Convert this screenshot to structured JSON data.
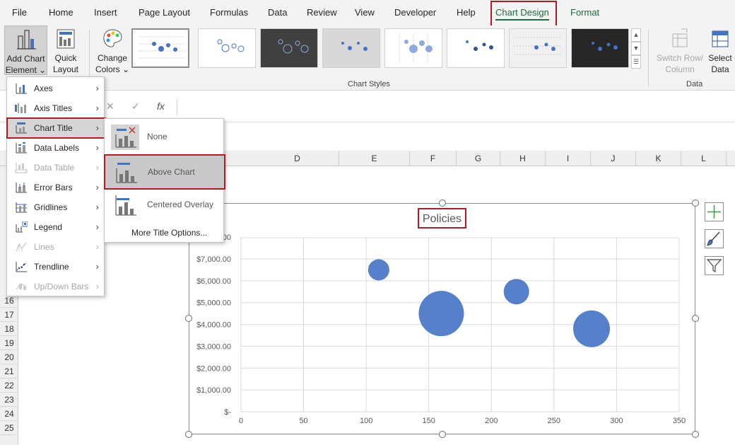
{
  "ribbon": {
    "tabs": [
      {
        "label": "File"
      },
      {
        "label": "Home"
      },
      {
        "label": "Insert"
      },
      {
        "label": "Page Layout"
      },
      {
        "label": "Formulas"
      },
      {
        "label": "Data"
      },
      {
        "label": "Review"
      },
      {
        "label": "View"
      },
      {
        "label": "Developer"
      },
      {
        "label": "Help"
      },
      {
        "label": "Chart Design"
      },
      {
        "label": "Format"
      }
    ],
    "buttons": {
      "add_chart_element_1": "Add Chart",
      "add_chart_element_2": "Element ⌄",
      "quick_layout_1": "Quick",
      "quick_layout_2": "Layout ⌄",
      "change_colors_1": "Change",
      "change_colors_2": "Colors ⌄",
      "switch_row_1": "Switch Row/",
      "switch_row_2": "Column",
      "select_data_1": "Select",
      "select_data_2": "Data"
    },
    "groups": {
      "chart_styles": "Chart Styles",
      "data": "Data"
    }
  },
  "formula_bar": {
    "cancel": "✕",
    "enter": "✓",
    "fx": "fx"
  },
  "columns": [
    "D",
    "E",
    "F",
    "G",
    "H",
    "I",
    "J",
    "K",
    "L"
  ],
  "rows": [
    "16",
    "17",
    "18",
    "19",
    "20",
    "21",
    "22",
    "23",
    "24",
    "25"
  ],
  "menu": {
    "items": [
      {
        "label": "Axes",
        "icon": "axes-icon"
      },
      {
        "label": "Axis Titles",
        "icon": "axis-titles-icon"
      },
      {
        "label": "Chart Title",
        "icon": "chart-title-icon"
      },
      {
        "label": "Data Labels",
        "icon": "data-labels-icon"
      },
      {
        "label": "Data Table",
        "icon": "data-table-icon"
      },
      {
        "label": "Error Bars",
        "icon": "error-bars-icon"
      },
      {
        "label": "Gridlines",
        "icon": "gridlines-icon"
      },
      {
        "label": "Legend",
        "icon": "legend-icon"
      },
      {
        "label": "Lines",
        "icon": "lines-icon"
      },
      {
        "label": "Trendline",
        "icon": "trendline-icon"
      },
      {
        "label": "Up/Down Bars",
        "icon": "up-down-bars-icon"
      }
    ],
    "submenu": {
      "items": [
        {
          "label": "None"
        },
        {
          "label": "Above Chart"
        },
        {
          "label": "Centered Overlay"
        }
      ],
      "more": "More Title Options..."
    }
  },
  "chart_data": {
    "type": "scatter",
    "title": "Policies",
    "xlim": [
      0,
      350
    ],
    "ylim": [
      0,
      7000
    ],
    "x_ticks": [
      "0",
      "50",
      "100",
      "150",
      "200",
      "250",
      "300",
      "350"
    ],
    "y_ticks": [
      "$-",
      "$1,000.00",
      "$2,000.00",
      "$3,000.00",
      "$4,000.00",
      "$5,000.00",
      "$6,000.00",
      "$7,000.00"
    ],
    "y_top_partial": "00",
    "color": "#4472c4",
    "points": [
      {
        "x": 110,
        "y": 6500,
        "size": 30
      },
      {
        "x": 160,
        "y": 4500,
        "size": 64
      },
      {
        "x": 220,
        "y": 5500,
        "size": 36
      },
      {
        "x": 280,
        "y": 3800,
        "size": 52
      }
    ]
  }
}
